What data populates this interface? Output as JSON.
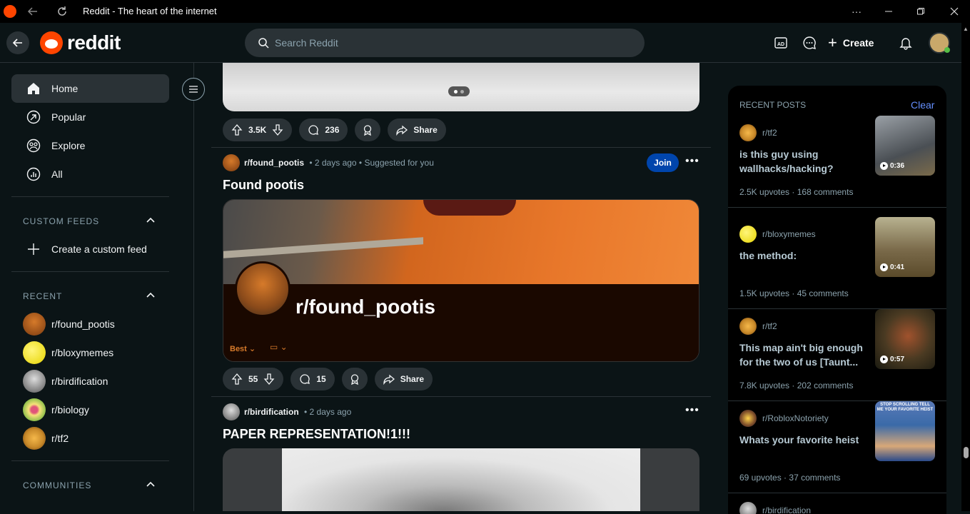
{
  "window": {
    "title": "Reddit - The heart of the internet",
    "icons": [
      "back-arrow-icon",
      "reload-icon",
      "more-icon",
      "minimize-icon",
      "restore-icon",
      "close-icon"
    ]
  },
  "header": {
    "brand": "reddit",
    "search_placeholder": "Search Reddit",
    "create_label": "Create",
    "icons": [
      "advertise-icon",
      "chat-icon",
      "plus-icon",
      "notification-bell-icon",
      "user-avatar"
    ]
  },
  "sidebar": {
    "nav": [
      {
        "label": "Home",
        "icon": "home-icon",
        "active": true
      },
      {
        "label": "Popular",
        "icon": "popular-icon"
      },
      {
        "label": "Explore",
        "icon": "explore-icon"
      },
      {
        "label": "All",
        "icon": "all-icon"
      }
    ],
    "custom_feeds": {
      "title": "CUSTOM FEEDS",
      "create_label": "Create a custom feed"
    },
    "recent": {
      "title": "RECENT",
      "items": [
        {
          "name": "r/found_pootis",
          "color": "#b5651d"
        },
        {
          "name": "r/bloxymemes",
          "color": "#f5e400"
        },
        {
          "name": "r/birdification",
          "color": "#8a8a8a"
        },
        {
          "name": "r/biology",
          "color": "#8fbf4a"
        },
        {
          "name": "r/tf2",
          "color": "#c98a2a"
        }
      ]
    },
    "communities": {
      "title": "COMMUNITIES"
    }
  },
  "feed": {
    "post1": {
      "upvotes": "3.5K",
      "comments": "236",
      "share_label": "Share"
    },
    "post2": {
      "subreddit": "r/found_pootis",
      "time": "2 days ago",
      "suggested": "Suggested for you",
      "join_label": "Join",
      "title": "Found pootis",
      "banner_name": "r/found_pootis",
      "banner_sort": "Best",
      "upvotes": "55",
      "comments": "15",
      "share_label": "Share"
    },
    "post3": {
      "subreddit": "r/birdification",
      "time": "2 days ago",
      "title": "PAPER REPRESENTATION!1!!!"
    }
  },
  "rail": {
    "title": "RECENT POSTS",
    "clear_label": "Clear",
    "posts": [
      {
        "sub": "r/tf2",
        "title": "is this guy using wallhacks/hacking?",
        "upvotes": "2.5K upvotes",
        "comments": "168 comments",
        "duration": "0:36",
        "thumb": "#6a7076"
      },
      {
        "sub": "r/bloxymemes",
        "title": "the method:",
        "upvotes": "1.5K upvotes",
        "comments": "45 comments",
        "duration": "0:41",
        "thumb": "#8a7a5a"
      },
      {
        "sub": "r/tf2",
        "title": "This map ain't big enough for the two of us [Taunt...",
        "upvotes": "7.8K upvotes",
        "comments": "202 comments",
        "duration": "0:57",
        "thumb": "#4a3a22"
      },
      {
        "sub": "r/RobloxNotoriety",
        "title": "Whats your favorite heist",
        "upvotes": "69 upvotes",
        "comments": "37 comments",
        "thumb_caption": "STOP SCROLLING TELL ME YOUR FAVORITE HEIST",
        "thumb": "#3a6aa8"
      },
      {
        "sub": "r/birdification"
      }
    ]
  }
}
